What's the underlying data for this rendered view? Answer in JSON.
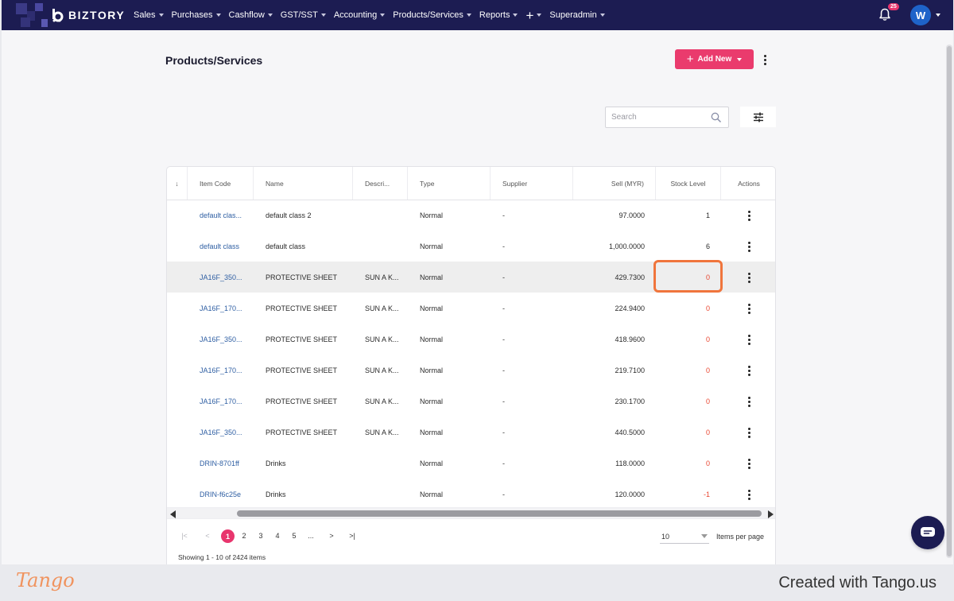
{
  "app": {
    "brand": "BIZTORY",
    "nav": [
      {
        "label": "Sales"
      },
      {
        "label": "Purchases"
      },
      {
        "label": "Cashflow"
      },
      {
        "label": "GST/SST"
      },
      {
        "label": "Accounting"
      },
      {
        "label": "Products/Services"
      },
      {
        "label": "Reports"
      },
      {
        "label": "+"
      },
      {
        "label": "Superadmin"
      }
    ],
    "notification_count": "25",
    "avatar_initial": "W"
  },
  "page": {
    "title": "Products/Services",
    "add_button_label": "Add New",
    "search_placeholder": "Search"
  },
  "table": {
    "sort_icon": "↓",
    "headers": {
      "item_code": "Item Code",
      "name": "Name",
      "description": "Descri...",
      "type": "Type",
      "supplier": "Supplier",
      "sell": "Sell (MYR)",
      "stock": "Stock Level",
      "actions": "Actions"
    },
    "rows": [
      {
        "code": "default clas...",
        "name": "default class 2",
        "desc": "",
        "type": "Normal",
        "supplier": "-",
        "sell": "97.0000",
        "stock": "1"
      },
      {
        "code": "default class",
        "name": "default class",
        "desc": "",
        "type": "Normal",
        "supplier": "-",
        "sell": "1,000.0000",
        "stock": "6"
      },
      {
        "code": "JA16F_350...",
        "name": "PROTECTIVE SHEET",
        "desc": "SUN A K...",
        "type": "Normal",
        "supplier": "-",
        "sell": "429.7300",
        "stock": "0"
      },
      {
        "code": "JA16F_170...",
        "name": "PROTECTIVE SHEET",
        "desc": "SUN A K...",
        "type": "Normal",
        "supplier": "-",
        "sell": "224.9400",
        "stock": "0"
      },
      {
        "code": "JA16F_350...",
        "name": "PROTECTIVE SHEET",
        "desc": "SUN A K...",
        "type": "Normal",
        "supplier": "-",
        "sell": "418.9600",
        "stock": "0"
      },
      {
        "code": "JA16F_170...",
        "name": "PROTECTIVE SHEET",
        "desc": "SUN A K...",
        "type": "Normal",
        "supplier": "-",
        "sell": "219.7100",
        "stock": "0"
      },
      {
        "code": "JA16F_170...",
        "name": "PROTECTIVE SHEET",
        "desc": "SUN A K...",
        "type": "Normal",
        "supplier": "-",
        "sell": "230.1700",
        "stock": "0"
      },
      {
        "code": "JA16F_350...",
        "name": "PROTECTIVE SHEET",
        "desc": "SUN A K...",
        "type": "Normal",
        "supplier": "-",
        "sell": "440.5000",
        "stock": "0"
      },
      {
        "code": "DRIN-8701ff",
        "name": "Drinks",
        "desc": "",
        "type": "Normal",
        "supplier": "-",
        "sell": "118.0000",
        "stock": "0"
      },
      {
        "code": "DRIN-f6c25e",
        "name": "Drinks",
        "desc": "",
        "type": "Normal",
        "supplier": "-",
        "sell": "120.0000",
        "stock": "-1"
      }
    ]
  },
  "pagination": {
    "first": "|<",
    "prev": "<",
    "pages": [
      "1",
      "2",
      "3",
      "4",
      "5"
    ],
    "ellipsis": "...",
    "next": ">",
    "last": ">|",
    "current_page": "1",
    "per_page_value": "10",
    "per_page_label": "Items per page",
    "showing": "Showing 1 - 10 of 2424 items"
  },
  "footer": {
    "logo": "Tango",
    "credit": "Created with Tango.us"
  },
  "colors": {
    "navbar": "#1c1c52",
    "accent": "#ea3b6d",
    "link": "#2f5fa3",
    "negative_stock": "#e8452f",
    "focus_outline": "#f0753c"
  }
}
